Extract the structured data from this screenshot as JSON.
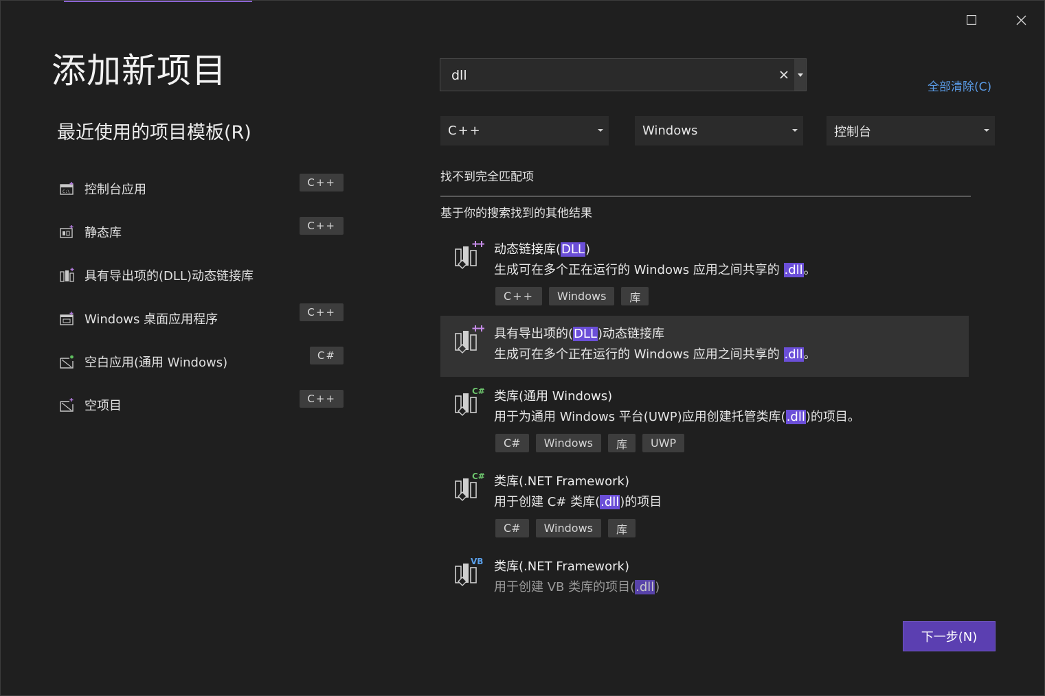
{
  "dialog": {
    "title": "添加新项目",
    "recent_title": "最近使用的项目模板(R)",
    "maximize_icon": "maximize-icon",
    "close_icon": "close-icon"
  },
  "recent": {
    "items": [
      {
        "label": "控制台应用",
        "tag": "C++",
        "icon": "console-app-icon"
      },
      {
        "label": "静态库",
        "tag": "C++",
        "icon": "static-library-icon"
      },
      {
        "label": "具有导出项的(DLL)动态链接库",
        "tag": "",
        "icon": "dll-icon"
      },
      {
        "label": "Windows 桌面应用程序",
        "tag": "C++",
        "icon": "desktop-app-icon"
      },
      {
        "label": "空白应用(通用 Windows)",
        "tag": "C#",
        "icon": "blank-app-icon"
      },
      {
        "label": "空项目",
        "tag": "C++",
        "icon": "empty-project-icon"
      }
    ]
  },
  "search": {
    "value": "dll",
    "clear_all": "全部清除(C)"
  },
  "filters": {
    "language": "C++",
    "platform": "Windows",
    "project_type": "控制台"
  },
  "results": {
    "no_match": "找不到完全匹配项",
    "other_results": "基于你的搜索找到的其他结果",
    "items": [
      {
        "title_pre": "动态链接库(",
        "title_hl": "DLL",
        "title_post": ")",
        "desc_pre": "生成可在多个正在运行的 Windows 应用之间共享的 ",
        "desc_hl": ".dll",
        "desc_post": "。",
        "tags": [
          "C++",
          "Windows",
          "库"
        ],
        "badge": "++"
      },
      {
        "title_pre": "具有导出项的(",
        "title_hl": "DLL",
        "title_post": ")动态链接库",
        "desc_pre": "生成可在多个正在运行的 Windows 应用之间共享的 ",
        "desc_hl": ".dll",
        "desc_post": "。",
        "tags": [],
        "badge": "++"
      },
      {
        "title_pre": "类库(通用 Windows)",
        "title_hl": "",
        "title_post": "",
        "desc_pre": "用于为通用 Windows 平台(UWP)应用创建托管类库(",
        "desc_hl": ".dll",
        "desc_post": ")的项目。",
        "tags": [
          "C#",
          "Windows",
          "库",
          "UWP"
        ],
        "badge": "C#"
      },
      {
        "title_pre": "类库(.NET Framework)",
        "title_hl": "",
        "title_post": "",
        "desc_pre": "用于创建 C# 类库(",
        "desc_hl": ".dll",
        "desc_post": ")的项目",
        "tags": [
          "C#",
          "Windows",
          "库"
        ],
        "badge": "C#"
      },
      {
        "title_pre": "类库(.NET Framework)",
        "title_hl": "",
        "title_post": "",
        "desc_pre": "用于创建 VB 类库的项目(",
        "desc_hl": ".dll",
        "desc_post": ")",
        "tags": [],
        "badge": "VB"
      }
    ]
  },
  "footer": {
    "next_label": "下一步(N)"
  },
  "colors": {
    "accent": "#5b3fb1",
    "highlight": "#6b4fd8",
    "link": "#5a9be6"
  }
}
